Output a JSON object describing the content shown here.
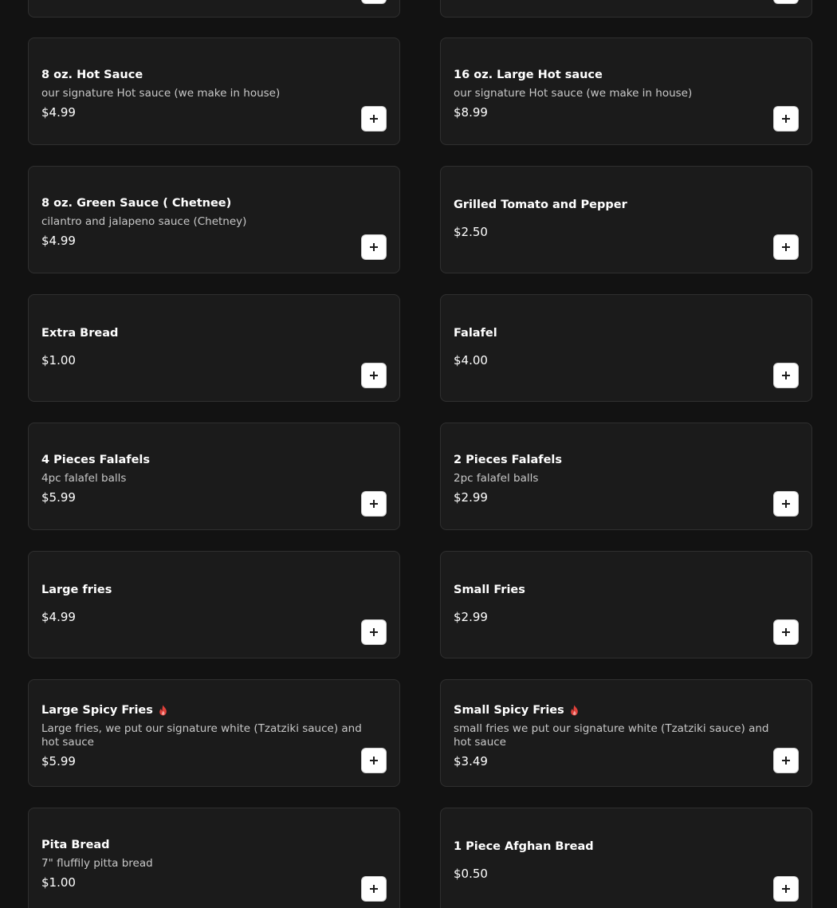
{
  "menu": {
    "add_icon": "plus-icon",
    "spicy_icon": "flame-icon",
    "spicy_color": "#e0403a",
    "items": [
      {
        "name": "",
        "description": "",
        "price": ""
      },
      {
        "name": "",
        "description": "",
        "price": ""
      },
      {
        "name": "8 oz. Hot Sauce",
        "description": "our signature Hot sauce (we make in house)",
        "price": "$4.99"
      },
      {
        "name": "16 oz. Large Hot sauce",
        "description": "our signature Hot sauce (we make in house)",
        "price": "$8.99"
      },
      {
        "name": "8 oz. Green Sauce ( Chetnee)",
        "description": "cilantro and jalapeno sauce (Chetney)",
        "price": "$4.99"
      },
      {
        "name": "Grilled Tomato and Pepper",
        "description": "",
        "price": "$2.50"
      },
      {
        "name": "Extra Bread",
        "description": "",
        "price": "$1.00"
      },
      {
        "name": "Falafel",
        "description": "",
        "price": "$4.00"
      },
      {
        "name": "4 Pieces Falafels",
        "description": "4pc falafel balls",
        "price": "$5.99"
      },
      {
        "name": "2 Pieces Falafels",
        "description": "2pc falafel balls",
        "price": "$2.99"
      },
      {
        "name": "Large fries",
        "description": "",
        "price": "$4.99"
      },
      {
        "name": "Small Fries",
        "description": "",
        "price": "$2.99"
      },
      {
        "name": "Large Spicy Fries",
        "description": "Large fries, we put our signature white (Tzatziki sauce) and hot sauce",
        "price": "$5.99",
        "spicy": true
      },
      {
        "name": "Small Spicy Fries",
        "description": "small fries we put our signature white (Tzatziki sauce) and hot sauce",
        "price": "$3.49",
        "spicy": true
      },
      {
        "name": "Pita Bread",
        "description": "7\" fluffily pitta bread",
        "price": "$1.00"
      },
      {
        "name": "1 Piece Afghan Bread",
        "description": "",
        "price": "$0.50"
      }
    ]
  }
}
